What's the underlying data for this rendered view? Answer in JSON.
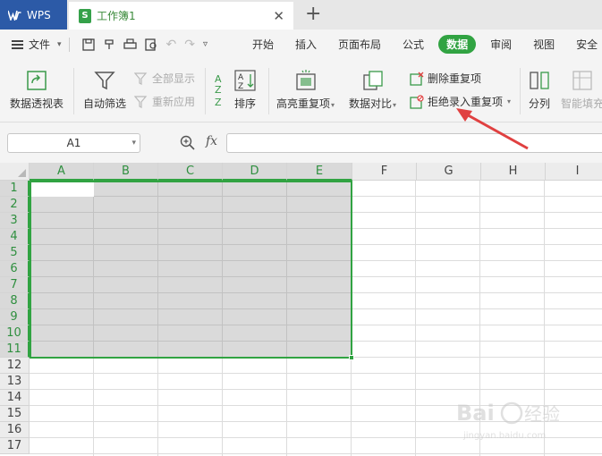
{
  "titlebar": {
    "app_label": "WPS",
    "doc_tab_label": "工作簿1",
    "new_tab_symbol": "+",
    "close_symbol": "✕"
  },
  "menubar": {
    "file_label": "文件",
    "items": [
      "开始",
      "插入",
      "页面布局",
      "公式",
      "数据",
      "审阅",
      "视图",
      "安全"
    ],
    "active_item": "数据"
  },
  "ribbon": {
    "pivot_label": "数据透视表",
    "autofilter_label": "自动筛选",
    "show_all_label": "全部显示",
    "reapply_label": "重新应用",
    "sort_label": "排序",
    "highlight_dup_label": "高亮重复项",
    "compare_label": "数据对比",
    "remove_dup_label": "删除重复项",
    "reject_dup_label": "拒绝录入重复项",
    "split_label": "分列",
    "smart_fill_label": "智能填充"
  },
  "formula_bar": {
    "name_box": "A1",
    "fx_label": "fx",
    "formula": ""
  },
  "grid": {
    "columns": [
      "A",
      "B",
      "C",
      "D",
      "E",
      "F",
      "G",
      "H",
      "I"
    ],
    "rows": [
      "1",
      "2",
      "3",
      "4",
      "5",
      "6",
      "7",
      "8",
      "9",
      "10",
      "11",
      "12",
      "13",
      "14",
      "15",
      "16",
      "17"
    ],
    "selected_range": "A1:E11",
    "active_cell": "A1"
  },
  "colors": {
    "accent": "#31a342",
    "wps_blue": "#2c5aa7",
    "arrow": "#e04040"
  }
}
